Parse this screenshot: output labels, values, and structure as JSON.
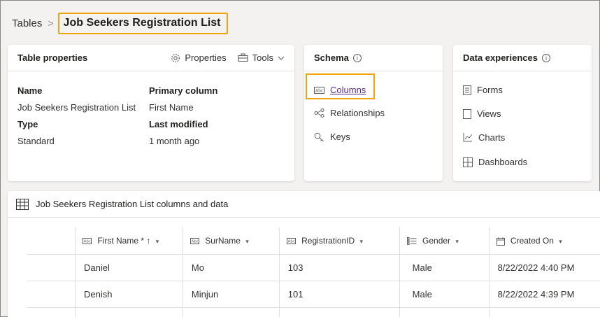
{
  "breadcrumb": {
    "root": "Tables",
    "separator": ">",
    "current": "Job Seekers Registration List"
  },
  "properties_card": {
    "title": "Table properties",
    "actions": {
      "properties": "Properties",
      "tools": "Tools"
    },
    "fields": {
      "name_label": "Name",
      "name_value": "Job Seekers Registration List",
      "type_label": "Type",
      "type_value": "Standard",
      "primary_label": "Primary column",
      "primary_value": "First Name",
      "modified_label": "Last modified",
      "modified_value": "1 month ago"
    }
  },
  "schema_card": {
    "title": "Schema",
    "links": {
      "columns": "Columns",
      "relationships": "Relationships",
      "keys": "Keys"
    }
  },
  "experiences_card": {
    "title": "Data experiences",
    "links": {
      "forms": "Forms",
      "views": "Views",
      "charts": "Charts",
      "dashboards": "Dashboards"
    }
  },
  "data_section": {
    "title": "Job Seekers Registration List columns and data",
    "columns": {
      "first_name": "First Name",
      "required_marker": "*",
      "sort_marker": "↑",
      "surname": "SurName",
      "registration_id": "RegistrationID",
      "gender": "Gender",
      "created_on": "Created On"
    },
    "rows": [
      {
        "first_name": "Daniel",
        "surname": "Mo",
        "registration_id": "103",
        "gender": "Male",
        "created_on": "8/22/2022 4:40 PM"
      },
      {
        "first_name": "Denish",
        "surname": "Minjun",
        "registration_id": "101",
        "gender": "Male",
        "created_on": "8/22/2022 4:39 PM"
      }
    ]
  },
  "icons": {
    "gear": "gear-icon",
    "toolbox": "toolbox-icon",
    "info": "info-icon",
    "columns": "text-column-icon",
    "relationships": "relationships-icon",
    "keys": "key-icon",
    "forms": "form-icon",
    "views": "view-icon",
    "charts": "chart-icon",
    "dashboards": "dashboard-icon",
    "table": "table-icon",
    "calendar": "calendar-icon",
    "choice": "choice-column-icon"
  },
  "colors": {
    "highlight": "#f0a30a",
    "link": "#5c2d91"
  }
}
